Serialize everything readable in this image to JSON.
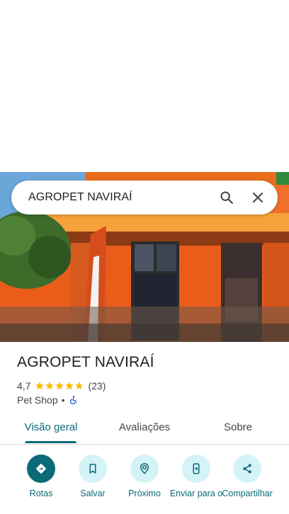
{
  "search": {
    "query": "AGROPET NAVIRAÍ"
  },
  "icons": {
    "search": "search-icon",
    "clear": "close-icon"
  },
  "place": {
    "name": "AGROPET NAVIRAÍ",
    "rating": "4,7",
    "rating_value": 4.7,
    "reviews": "(23)",
    "category": "Pet Shop",
    "separator": "•",
    "accessibility_icon": "wheelchair-icon"
  },
  "tabs": [
    {
      "label": "Visão geral",
      "active": true
    },
    {
      "label": "Avaliações",
      "active": false
    },
    {
      "label": "Sobre",
      "active": false
    }
  ],
  "actions": [
    {
      "label": "Rotas",
      "icon": "directions-icon"
    },
    {
      "label": "Salvar",
      "icon": "bookmark-icon"
    },
    {
      "label": "Próximo",
      "icon": "nearby-icon"
    },
    {
      "label": "Enviar para o",
      "icon": "send-to-phone-icon"
    },
    {
      "label": "Compartilhar",
      "icon": "share-icon"
    }
  ],
  "colors": {
    "accent": "#0b6a77",
    "accent_light": "#d4f3f7",
    "stars": "#fbbc04",
    "storefront": "#f26a1b"
  }
}
